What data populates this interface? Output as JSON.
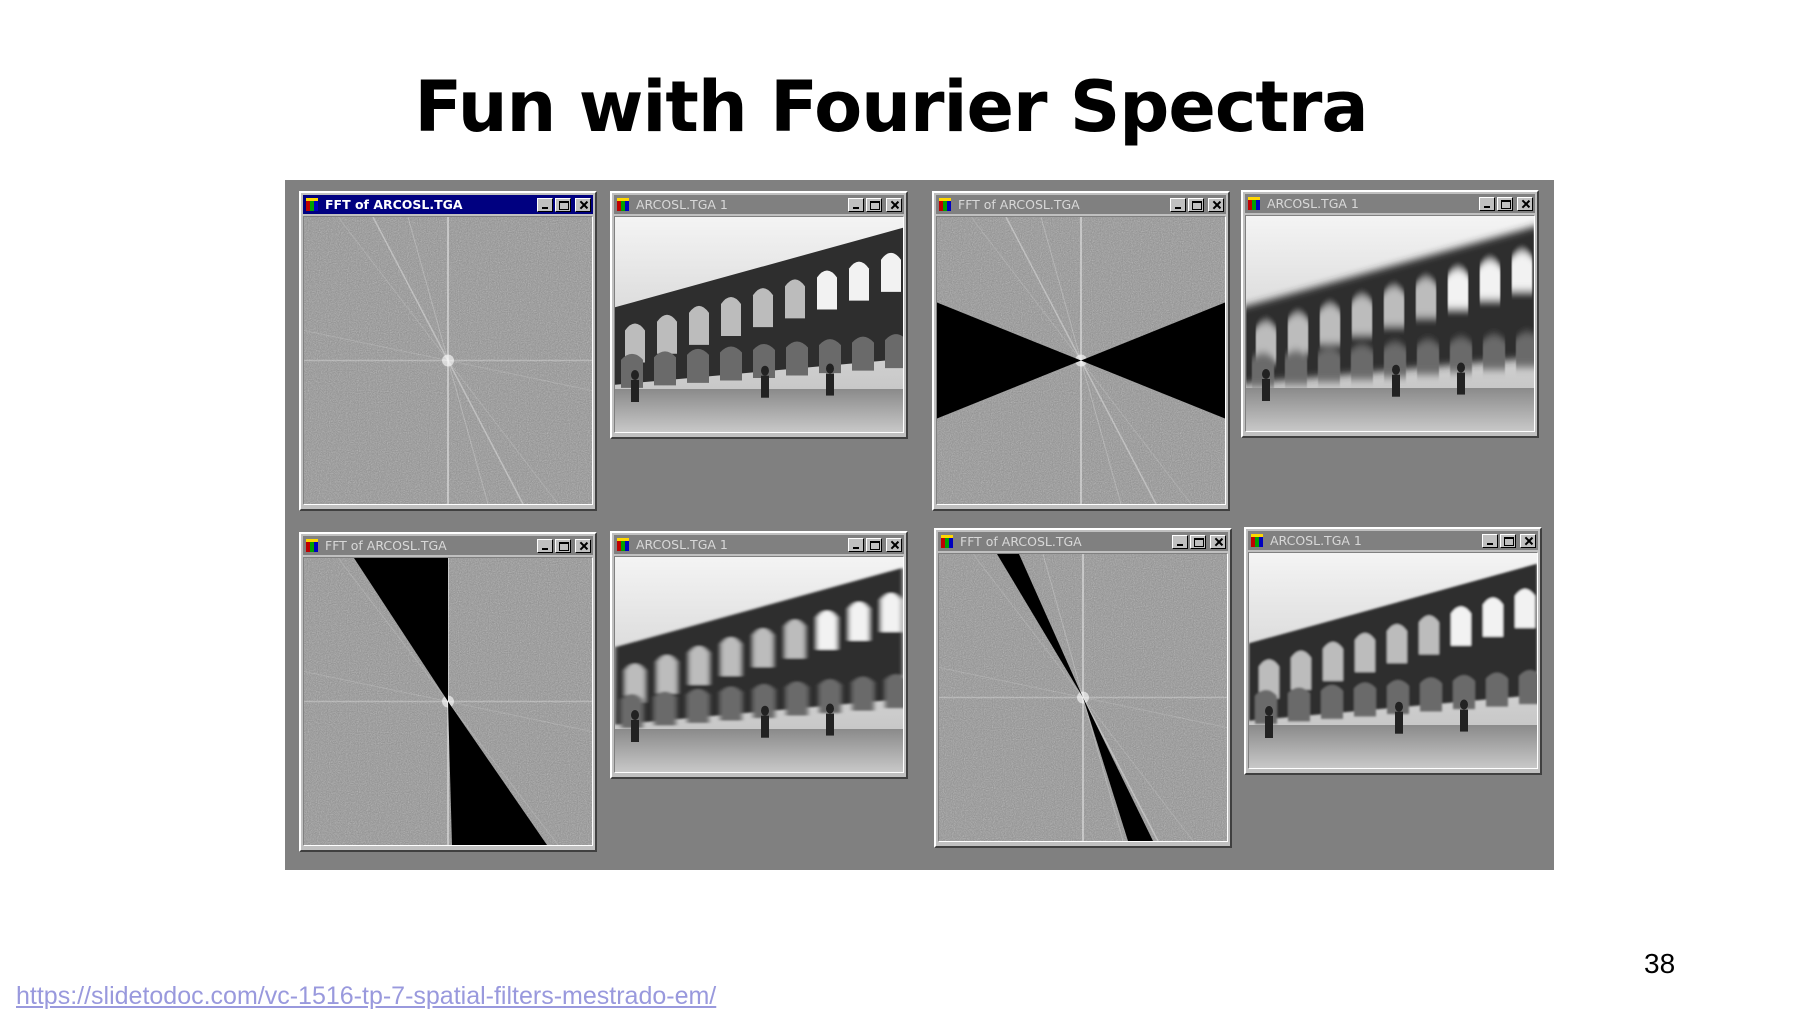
{
  "slide": {
    "title": "Fun with Fourier Spectra",
    "page_number": "38",
    "source_url": "https://slidetodoc.com/vc-1516-tp-7-spatial-filters-mestrado-em/"
  },
  "colors": {
    "panel_background": "#808080",
    "active_titlebar": "#000080",
    "inactive_titlebar": "#808080",
    "link": "#9999dd"
  },
  "windows": [
    {
      "title": "FFT of ARCOSL.TGA",
      "active": true,
      "content": "fft",
      "mask": "none"
    },
    {
      "title": "ARCOSL.TGA 1",
      "active": false,
      "content": "photo",
      "variant": "original"
    },
    {
      "title": "FFT of ARCOSL.TGA",
      "active": false,
      "content": "fft",
      "mask": "horizontal-wedge"
    },
    {
      "title": "ARCOSL.TGA 1",
      "active": false,
      "content": "photo",
      "variant": "vertical-blur"
    },
    {
      "title": "FFT of ARCOSL.TGA",
      "active": false,
      "content": "fft",
      "mask": "half-diagonal-wedge"
    },
    {
      "title": "ARCOSL.TGA 1",
      "active": false,
      "content": "photo",
      "variant": "diagonal-blur"
    },
    {
      "title": "FFT of ARCOSL.TGA",
      "active": false,
      "content": "fft",
      "mask": "narrow-diagonal-wedge"
    },
    {
      "title": "ARCOSL.TGA 1",
      "active": false,
      "content": "photo",
      "variant": "mild-filter"
    }
  ],
  "icons": {
    "app": "paint-app-icon",
    "minimize": "minimize-icon",
    "maximize": "maximize-icon",
    "close": "close-icon"
  }
}
